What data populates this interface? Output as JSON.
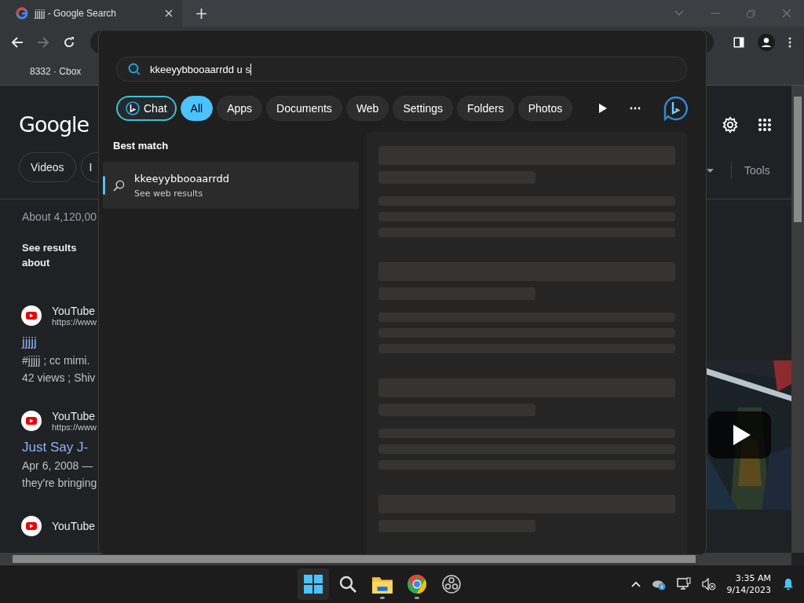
{
  "browser": {
    "tab": {
      "title": "jjjjj - Google Search"
    },
    "bookmarks": [
      {
        "label": "8332 · Cbox"
      }
    ],
    "forward_disabled": true
  },
  "page": {
    "logo": "Google",
    "chips": [
      {
        "label": "Videos"
      },
      {
        "label": "I"
      }
    ],
    "tools": "Tools",
    "result_count": "About 4,120,00",
    "see_results": "See results about",
    "results": [
      {
        "source": "YouTube",
        "url": "https://www",
        "title": "jjjjj",
        "lines": [
          "#jjjjj ; cc mimi.",
          "42 views ; Shiv"
        ]
      },
      {
        "source": "YouTube",
        "url": "https://www",
        "title": "Just Say J-",
        "lines": [
          "Apr 6, 2008 —",
          "they're bringing"
        ]
      },
      {
        "source": "YouTube"
      }
    ]
  },
  "search_overlay": {
    "query": "kkeeyybbooaarrdd u s",
    "filters": [
      {
        "label": "Chat",
        "kind": "chat",
        "selected": false
      },
      {
        "label": "All",
        "kind": "text",
        "selected": true
      },
      {
        "label": "Apps",
        "kind": "text",
        "selected": false
      },
      {
        "label": "Documents",
        "kind": "text",
        "selected": false
      },
      {
        "label": "Web",
        "kind": "text",
        "selected": false
      },
      {
        "label": "Settings",
        "kind": "text",
        "selected": false
      },
      {
        "label": "Folders",
        "kind": "text",
        "selected": false
      },
      {
        "label": "Photos",
        "kind": "text",
        "selected": false
      }
    ],
    "section_title": "Best match",
    "best_match": {
      "title": "kkeeyybbooaarrdd",
      "subtitle": "See web results",
      "selected": true
    }
  },
  "taskbar": {
    "apps": [
      {
        "kind": "start",
        "running": false
      },
      {
        "kind": "search",
        "running": false
      },
      {
        "kind": "files",
        "running": true
      },
      {
        "kind": "chrome",
        "running": true
      },
      {
        "kind": "obs",
        "running": false
      }
    ],
    "time": "3:35 AM",
    "date": "9/14/2023"
  }
}
